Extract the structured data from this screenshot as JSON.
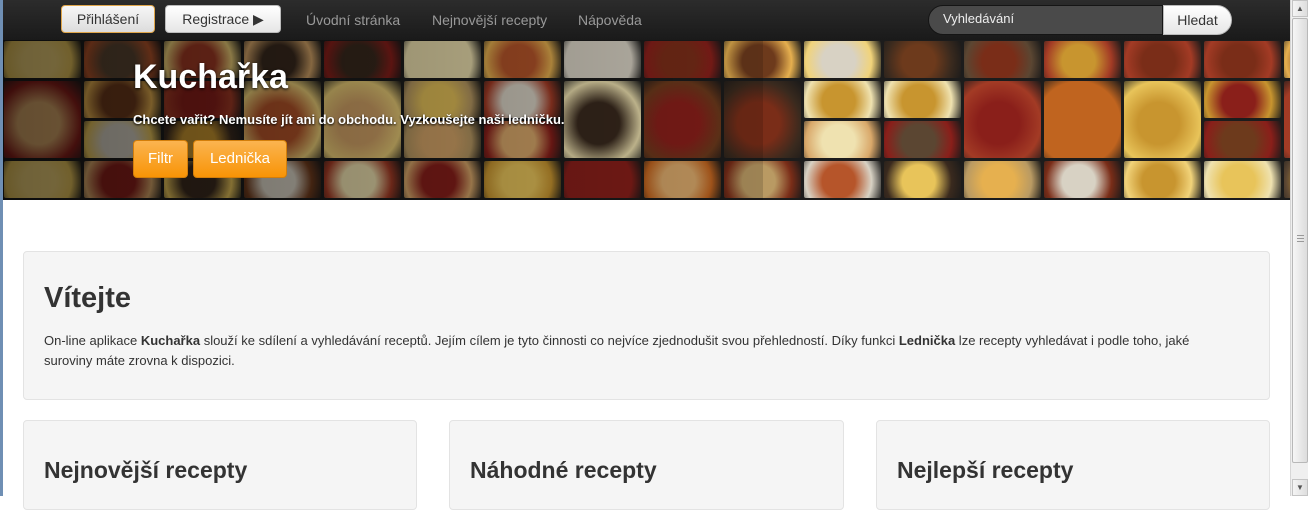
{
  "navbar": {
    "login_label": "Přihlášení",
    "register_label": "Registrace ▶",
    "links": [
      "Úvodní stránka",
      "Nejnovější recepty",
      "Nápověda"
    ],
    "search_placeholder": "Vyhledávání",
    "search_button": "Hledat"
  },
  "hero": {
    "title": "Kuchařka",
    "subtitle": "Chcete vařit? Nemusíte jít ani do obchodu. Vyzkoušejte naši ledničku.",
    "filter_button": "Filtr",
    "fridge_button": "Lednička",
    "accent_color": "#f89406"
  },
  "welcome": {
    "heading": "Vítejte",
    "text_before_app": "On-line aplikace ",
    "app_name": "Kuchařka",
    "text_middle": " slouží ke sdílení a vyhledávání receptů. Jejím cílem je tyto činnosti co nejvíce zjednodušit svou přehledností. Díky funkci ",
    "feature_name": "Lednička",
    "text_after": " lze recepty vyhledávat i podle toho, jaké suroviny máte zrovna k dispozici."
  },
  "sections": [
    {
      "heading": "Nejnovější recepty"
    },
    {
      "heading": "Náhodné recepty"
    },
    {
      "heading": "Nejlepší recepty"
    }
  ]
}
